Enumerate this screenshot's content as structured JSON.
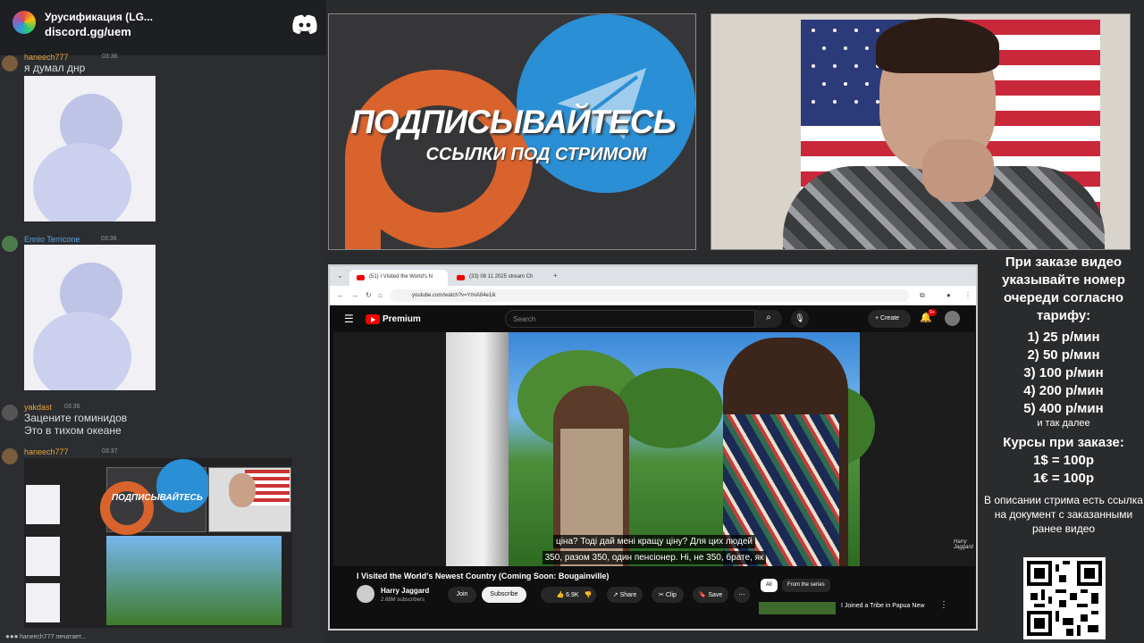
{
  "discord": {
    "server_name": "Урусификация (LG...",
    "invite": "discord.gg/uem",
    "messages": [
      {
        "user": "haneech777",
        "badge": "UEB",
        "time": "03:36",
        "text": "я  думал днр"
      },
      {
        "user": "Ennio Terricone",
        "time": "03:36"
      },
      {
        "user": "yakdast",
        "time": "03:36",
        "lines": [
          "Зацените гоминидов",
          "Это в тихом океане"
        ]
      },
      {
        "user": "haneech777",
        "badge": "UEB",
        "time": "03:37"
      }
    ],
    "typing": "haneech777 печатает..."
  },
  "promo": {
    "title": "ПОДПИСЫВАЙТЕСЬ",
    "subtitle": "ССЫЛКИ ПОД СТРИМОМ"
  },
  "browser": {
    "tabs": [
      "(51) I Visited the World's N",
      "(33) 08 11 2025 stream Ch"
    ],
    "url": "youtube.com/watch?v=YmiA84e1ik"
  },
  "youtube": {
    "brand": "Premium",
    "search_placeholder": "Search",
    "create_label": "Create",
    "notif_badge": "9+",
    "video_title": "I Visited the World's Newest Country (Coming Soon: Bougainville)",
    "channel": "Harry Jaggard",
    "subscribers": "2.68M subscribers",
    "join": "Join",
    "subscribe": "Subscribe",
    "likes": "6.9K",
    "share": "Share",
    "clip": "Clip",
    "save": "Save",
    "chip_all": "All",
    "chip_series": "From the series",
    "related_title": "I Joined a Tribe in Papua New",
    "subtitle_line1": "ціна? Тоді дай мені кращу ціну? Для цих людей",
    "subtitle_line2": "350, разом 350, один пенсіонер. Ні, не 350, брате, як",
    "watermark": "Harry Jaggard"
  },
  "price": {
    "heading": "При заказе видео указывайте номер очереди согласно тарифу:",
    "items": [
      "1) 25 р/мин",
      "2) 50 р/мин",
      "3) 100 р/мин",
      "4) 200 р/мин",
      "5) 400 р/мин"
    ],
    "etc": "и так далее",
    "courses_title": "Курсы при заказе:",
    "rate_usd": "1$ = 100р",
    "rate_eur": "1€ = 100р",
    "description": "В описании стрима есть ссылка на документ с заказанными ранее видео"
  }
}
